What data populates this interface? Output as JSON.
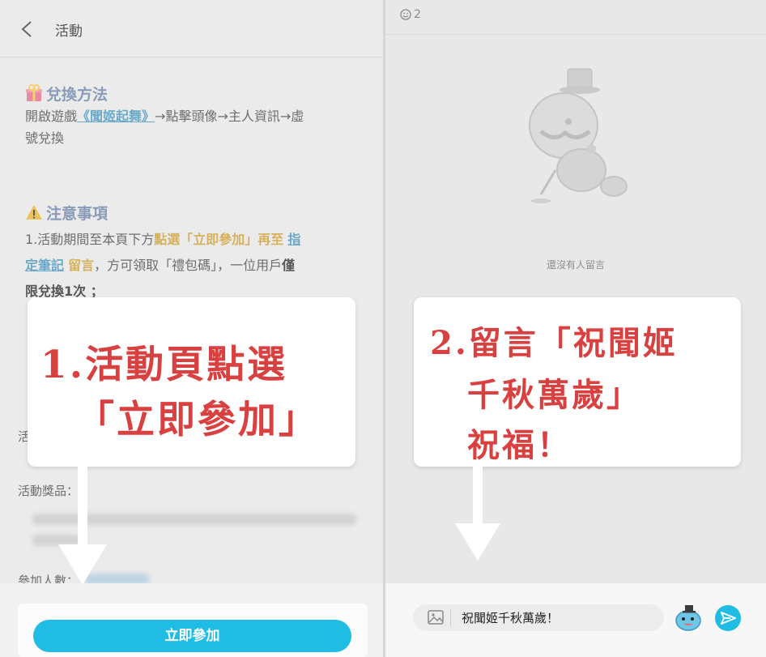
{
  "left": {
    "header": {
      "title": "活動"
    },
    "exchange": {
      "title": "兌換方法",
      "line1_prefix": "開啟遊戲",
      "game_link": "《聞姬起舞》",
      "line1_suffix": "→點擊頭像→主人資訊→虛",
      "line2": "號兌換"
    },
    "notice": {
      "title": "注意事項",
      "l1_a": "1.活動期間至本頁下方",
      "l1_b": "點選「立即參加」再至",
      "l1_c": "指",
      "l2_a": "定筆記",
      "l2_b": "留言",
      "l2_c": "，方可領取「禮包碼」，一位用戶",
      "l2_d": "僅",
      "l3": "限兌換1次 ；"
    },
    "meta": {
      "activity_prefix": "活",
      "prize_label": "活動獎品：",
      "participants_label": "參加人數："
    },
    "join_button": "立即參加"
  },
  "right": {
    "count": "2",
    "empty_text": "還沒有人留言",
    "comment_value": "祝聞姬千秋萬歲！"
  },
  "callout1": {
    "line1": "1.活動頁點選",
    "line2": "「立即參加」"
  },
  "callout2": {
    "line1": "2.留言「祝聞姬",
    "line2": "千秋萬歲」",
    "line3": "祝福！"
  },
  "colors": {
    "accent": "#1fbde4",
    "callout_text": "#d94040",
    "link": "#6aa9c9",
    "highlight": "#d7b15a"
  }
}
